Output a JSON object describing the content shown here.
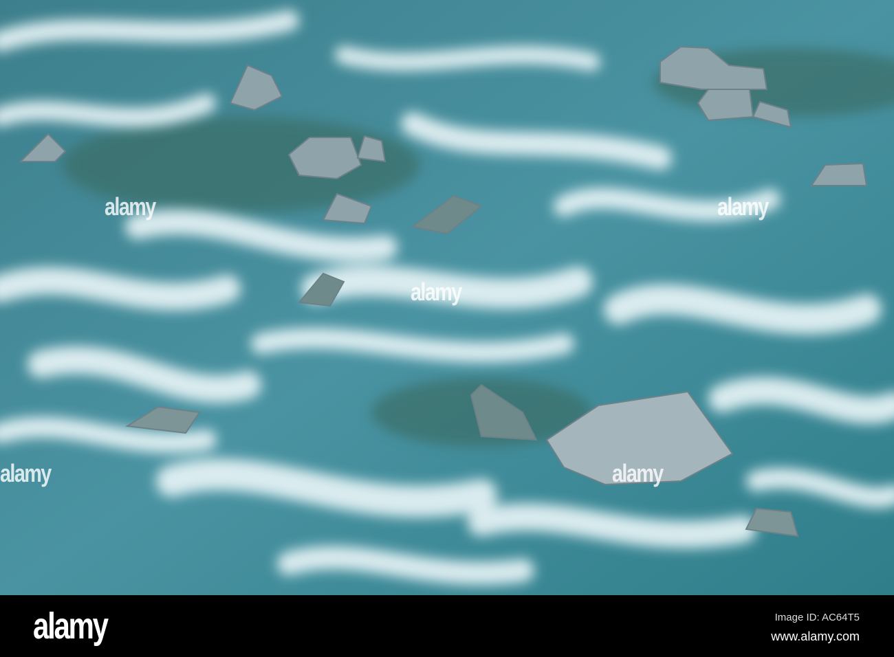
{
  "watermark": {
    "text": "alamy"
  },
  "footer": {
    "logo": "alamy",
    "image_id": "Image ID: AC64T5",
    "url": "www.alamy.com"
  },
  "colors": {
    "water": "#3f8a96",
    "foam": "#e8f4f7",
    "rock": "#8fa3ab",
    "footer_bg": "#000000"
  }
}
